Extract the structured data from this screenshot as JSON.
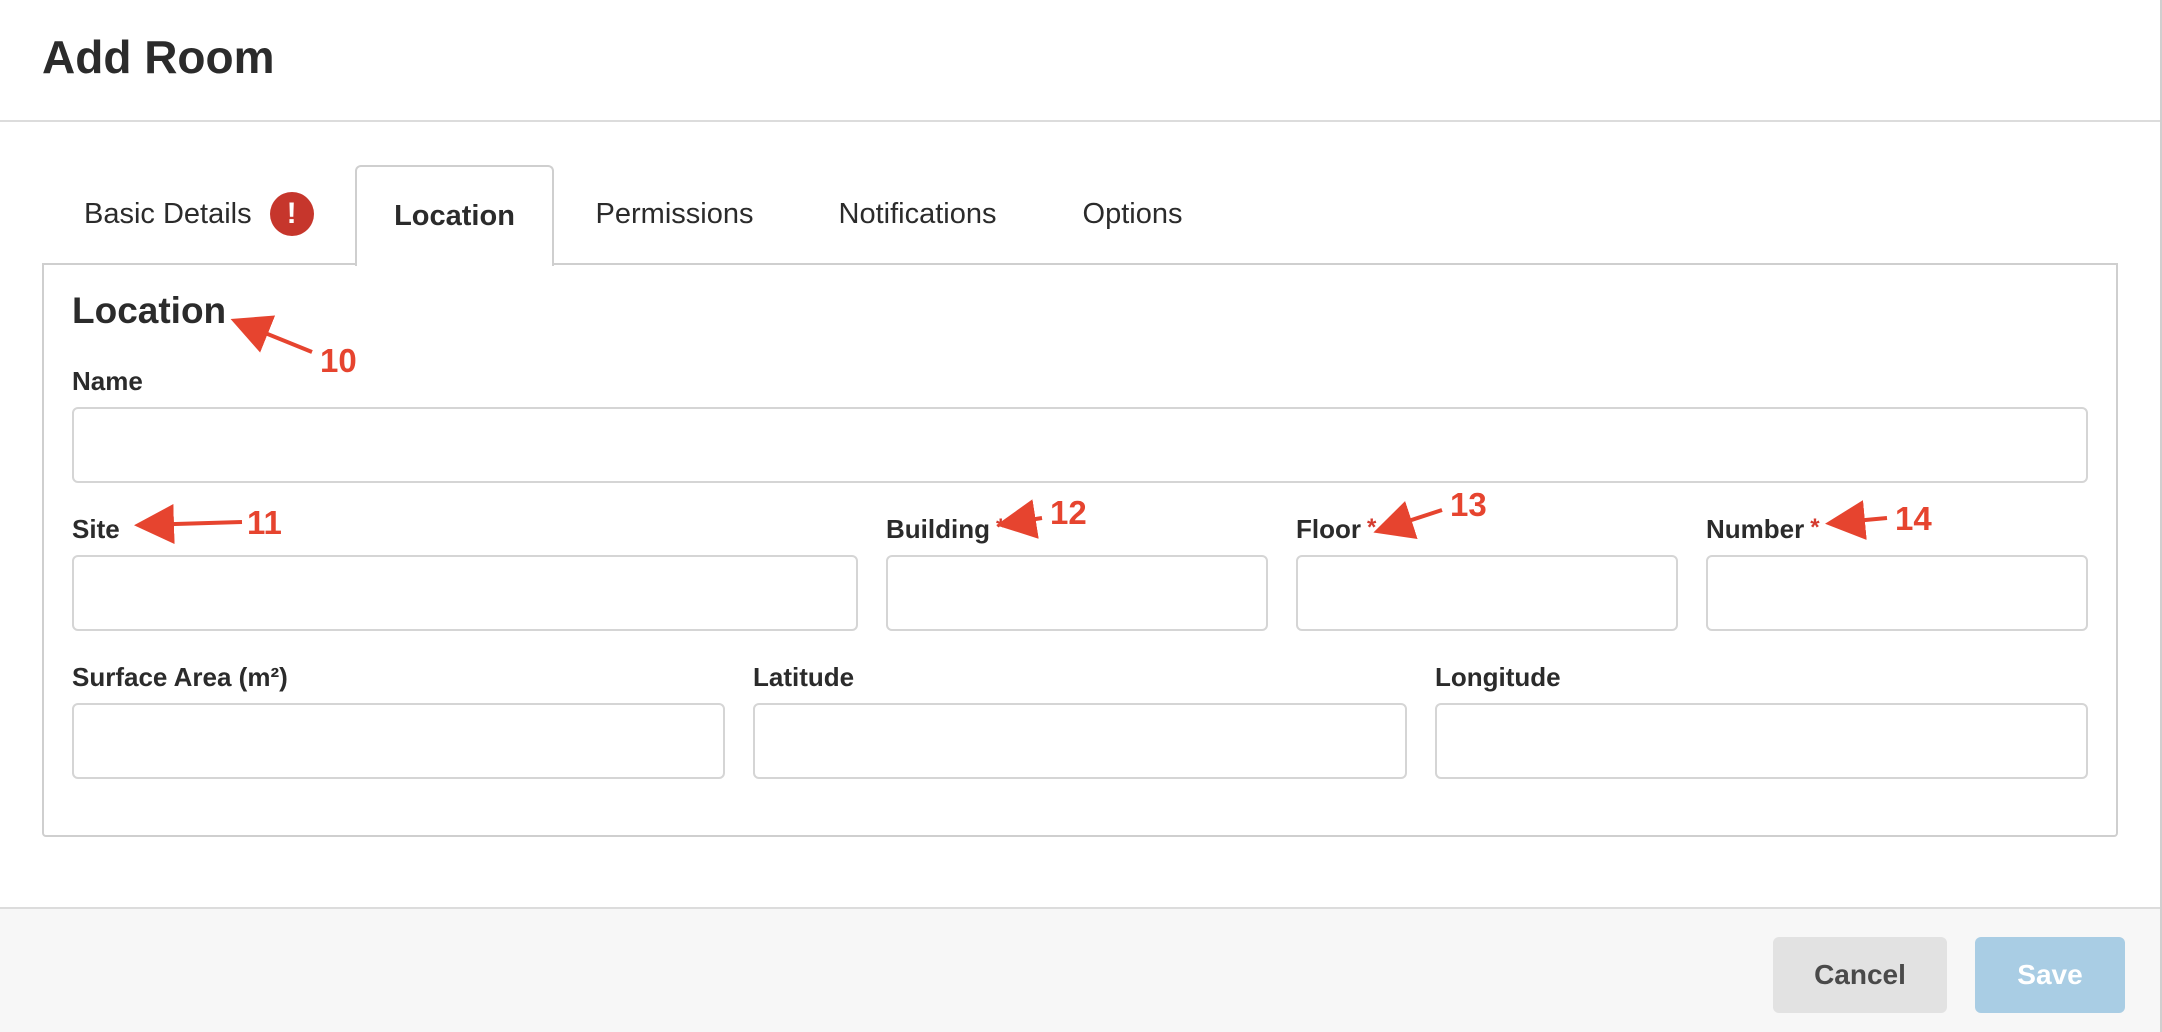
{
  "dialog": {
    "title": "Add Room"
  },
  "tabs": [
    {
      "label": "Basic Details",
      "has_error": true,
      "error_badge": "!"
    },
    {
      "label": "Location",
      "active": true
    },
    {
      "label": "Permissions"
    },
    {
      "label": "Notifications"
    },
    {
      "label": "Options"
    }
  ],
  "section": {
    "title": "Location"
  },
  "fields": {
    "name": {
      "label": "Name",
      "value": "",
      "placeholder": ""
    },
    "site": {
      "label": "Site",
      "value": "",
      "placeholder": ""
    },
    "building": {
      "label": "Building",
      "required_mark": "*",
      "value": "",
      "placeholder": ""
    },
    "floor": {
      "label": "Floor",
      "required_mark": "*",
      "value": "",
      "placeholder": ""
    },
    "number": {
      "label": "Number",
      "required_mark": "*",
      "value": "",
      "placeholder": ""
    },
    "surface_area": {
      "label": "Surface Area (m²)",
      "value": "",
      "placeholder": ""
    },
    "latitude": {
      "label": "Latitude",
      "value": "",
      "placeholder": ""
    },
    "longitude": {
      "label": "Longitude",
      "value": "",
      "placeholder": ""
    }
  },
  "annotations": [
    "10",
    "11",
    "12",
    "13",
    "14"
  ],
  "footer": {
    "cancel_label": "Cancel",
    "save_label": "Save"
  },
  "colors": {
    "error_badge": "#c6362c",
    "annotation": "#e6442f",
    "save_button": "#a9cde4",
    "cancel_button": "#e2e2e2"
  }
}
